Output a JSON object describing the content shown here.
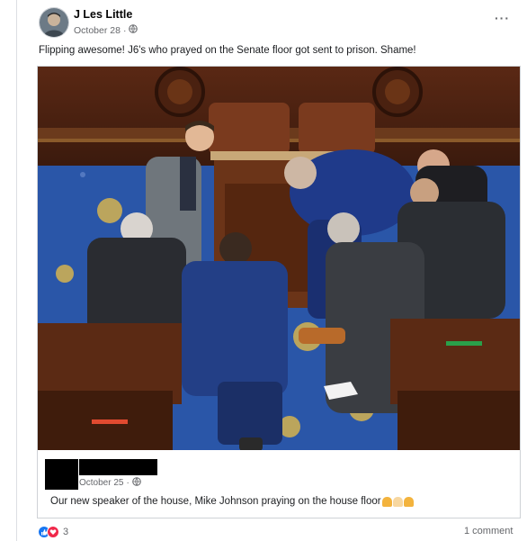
{
  "post": {
    "author": "J Les Little",
    "date": "October 28",
    "separator": "·",
    "text": "Flipping awesome! J6's who prayed on the Senate floor got sent to prison. Shame!",
    "more_icon": "more-options-icon",
    "audience_icon": "globe-icon"
  },
  "shared_post": {
    "date": "October 25",
    "separator": "·",
    "text": "Our new speaker of the house, Mike Johnson praying on the house floor",
    "emoji": [
      "pray",
      "pray",
      "pray"
    ]
  },
  "footer": {
    "reaction_icons": [
      "like-icon",
      "love-icon",
      "care-icon"
    ],
    "reaction_count": "3",
    "comment_count_label": "1 comment"
  },
  "colors": {
    "accent": "#1877f2",
    "muted": "#65676b",
    "love": "#f0284a",
    "carpet": "#2a56a8",
    "wood": "#5a2814"
  }
}
